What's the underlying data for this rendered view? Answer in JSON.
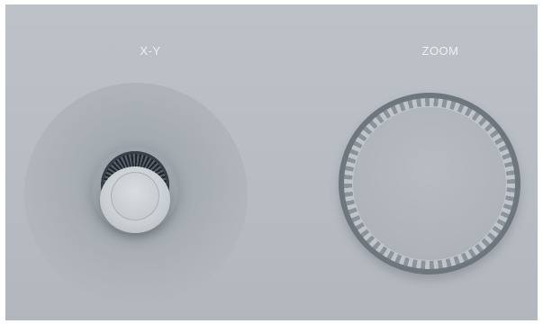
{
  "controls": {
    "xy": {
      "label": "X-Y"
    },
    "zoom": {
      "label": "ZOOM"
    }
  }
}
